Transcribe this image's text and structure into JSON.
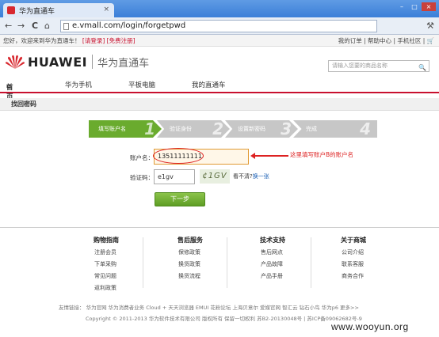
{
  "browser": {
    "tab_title": "华为直通车",
    "tab_close": "×",
    "url": "e.vmall.com/login/forgetpwd",
    "back": "←",
    "forward": "→",
    "reload": "C",
    "home": "⌂",
    "menu": "⚒",
    "win_min": "–",
    "win_max": "□",
    "win_close": "×"
  },
  "topbar": {
    "welcome": "您好，欢迎来到华为直通车！",
    "login": "[请登录]",
    "register": "[免费注册]",
    "links": "我的订单  |  帮助中心  |  手机社区  |  🛒"
  },
  "header": {
    "brand": "HUAWEI",
    "sub": "华为直通车",
    "search_placeholder": "请输入您要的商品名称",
    "search_icon": "🔍"
  },
  "mainnav": {
    "home": "首页",
    "phone": "华为手机",
    "tablet": "平板电脑",
    "mine": "我的直通车"
  },
  "breadcrumb": "找回密码",
  "steps": [
    {
      "label": "填写账户名",
      "num": "1",
      "color": "#6aab2e"
    },
    {
      "label": "验证身份",
      "num": "2",
      "color": "#c7c7c7"
    },
    {
      "label": "设置新密码",
      "num": "3",
      "color": "#c7c7c7"
    },
    {
      "label": "完成",
      "num": "4",
      "color": "#c7c7c7"
    }
  ],
  "form": {
    "account_label": "账户名：",
    "account_value": "13511111111",
    "captcha_label": "验证码：",
    "captcha_value": "e1gv",
    "captcha_image_text": "¢1GV",
    "captcha_hint": "看不清?",
    "captcha_refresh": "换一张",
    "next_button": "下一步"
  },
  "annotation": "这里填写账户B的账户名",
  "footer": {
    "columns": [
      {
        "title": "购物指南",
        "items": [
          "注册会员",
          "下单采购",
          "常见问题",
          "返利政策"
        ]
      },
      {
        "title": "售后服务",
        "items": [
          "保修政策",
          "换货政策",
          "换货流程"
        ]
      },
      {
        "title": "技术支持",
        "items": [
          "售后网点",
          "产品故障",
          "产品手册"
        ]
      },
      {
        "title": "关于商城",
        "items": [
          "公司介绍",
          "联系客服",
          "商务合作"
        ]
      }
    ],
    "friend_links": "友情链接：  华为官网   华为消费者业务   Cloud +   天天浏览器   EMUI   花粉论坛   上海贝意尔   爱媒官网   智汇云   钻石小鸟   华为p6   更多>>",
    "copyright": "Copyright © 2011-2013 华为软件技术有限公司 版权所有 保留一切权利 苏B2-20130048号 | 苏ICP备09062682号-9"
  },
  "watermark": "www.wooyun.org"
}
